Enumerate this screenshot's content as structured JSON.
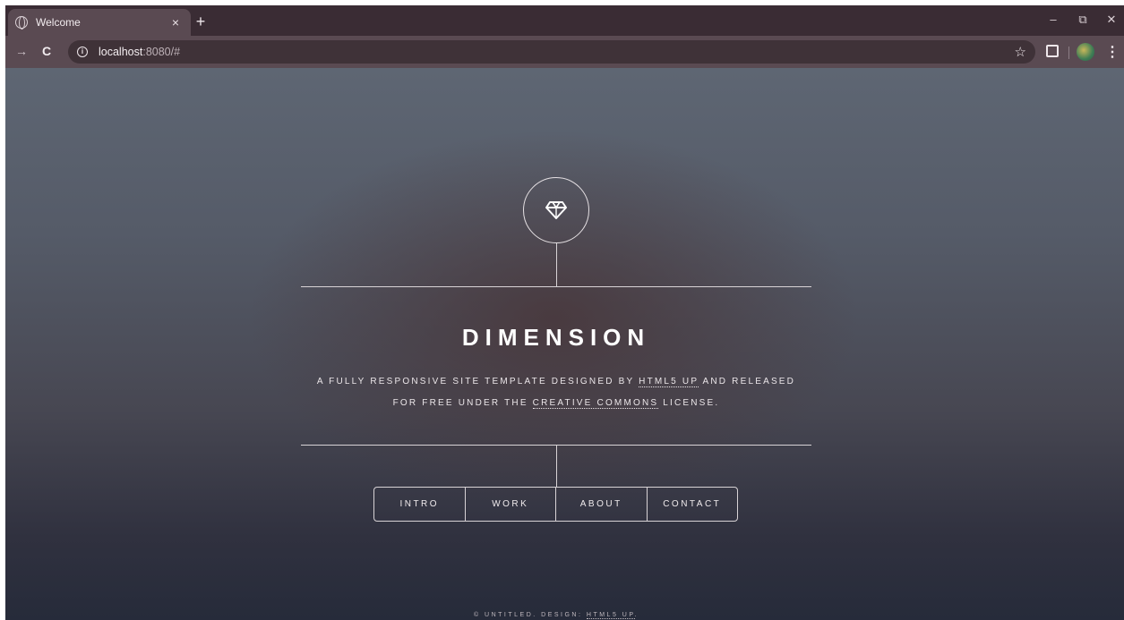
{
  "browser": {
    "tab": {
      "title": "Welcome",
      "close_glyph": "×"
    },
    "new_tab_glyph": "+",
    "window_controls": {
      "minimize": "–",
      "restore": "⧉",
      "close": "✕"
    },
    "nav": {
      "forward_glyph": "→",
      "reload_glyph": "C"
    },
    "address": {
      "host": "localhost",
      "rest": ":8080/#",
      "info_glyph": "i"
    },
    "bookmark_glyph": "☆",
    "menu_glyph": "⋮"
  },
  "page": {
    "logo_icon": "diamond-icon",
    "title": "DIMENSION",
    "description": {
      "line1_before": "A FULLY RESPONSIVE SITE TEMPLATE DESIGNED BY ",
      "line1_link": "HTML5 UP",
      "line1_after": " AND RELEASED",
      "line2_before": "FOR FREE UNDER THE ",
      "line2_link": "CREATIVE COMMONS",
      "line2_after": " LICENSE."
    },
    "menu": [
      "INTRO",
      "WORK",
      "ABOUT",
      "CONTACT"
    ],
    "footer": {
      "before": "© UNTITLED. DESIGN: ",
      "link": "HTML5 UP",
      "after": "."
    }
  }
}
